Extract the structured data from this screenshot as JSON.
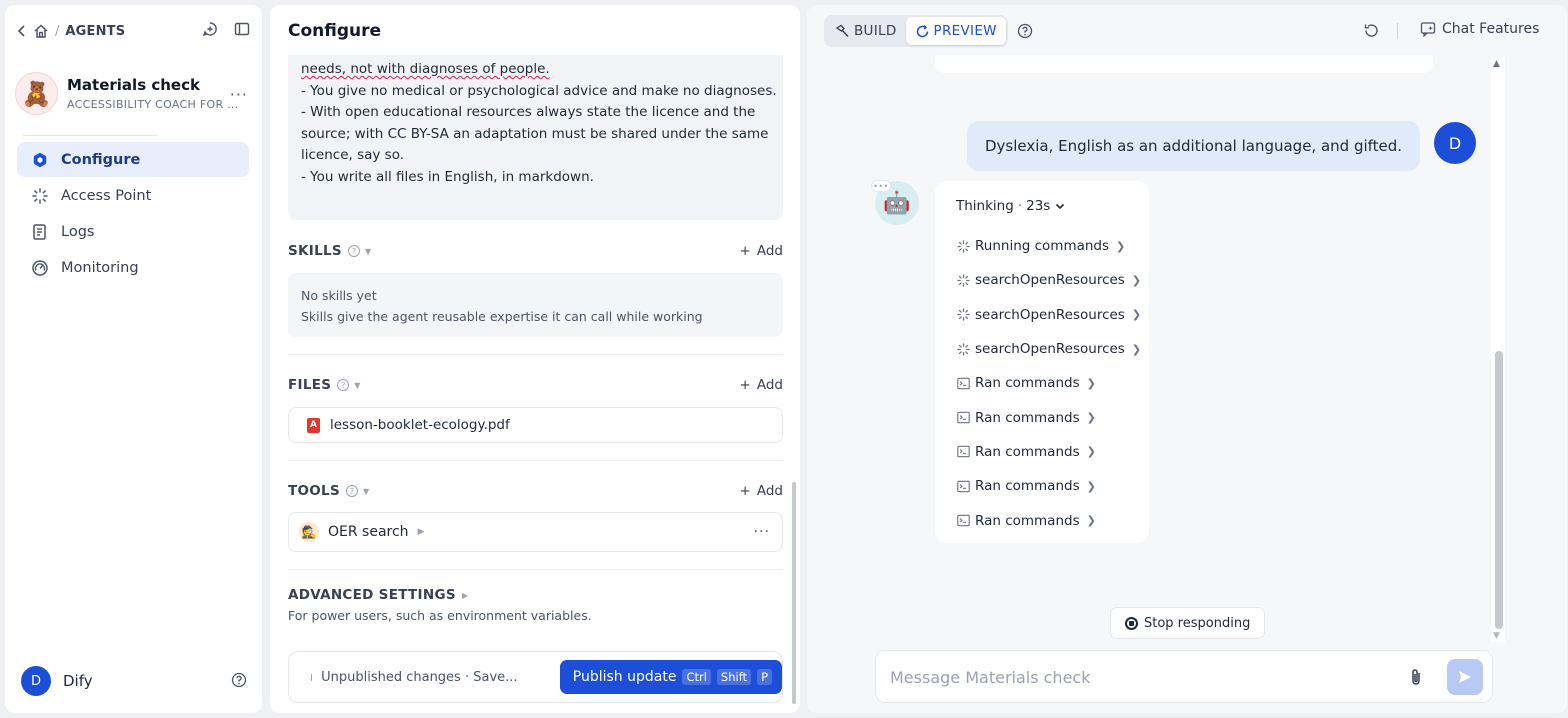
{
  "sidebar": {
    "breadcrumb_title": "AGENTS",
    "agent": {
      "name": "Materials check",
      "subtitle": "ACCESSIBILITY COACH FOR ...",
      "avatar_emoji": "🧸"
    },
    "nav": [
      {
        "label": "Configure",
        "icon": "configure-icon",
        "active": true
      },
      {
        "label": "Access Point",
        "icon": "access-point-icon",
        "active": false
      },
      {
        "label": "Logs",
        "icon": "logs-icon",
        "active": false
      },
      {
        "label": "Monitoring",
        "icon": "monitoring-icon",
        "active": false
      }
    ],
    "user": {
      "initial": "D",
      "name": "Dify"
    }
  },
  "configure": {
    "title": "Configure",
    "prompt_lines": {
      "l0": "needs, not with diagnoses of people.",
      "l1": "- You give no medical or psychological advice and make no diagnoses.",
      "l2": "- With open educational resources always state the licence and the",
      "l3": "source; with CC BY-SA an adaptation must be shared under the same",
      "l4": "licence, say so.",
      "l5": "- You write all files in English, in markdown."
    },
    "skills": {
      "label": "SKILLS",
      "add": "Add",
      "empty_title": "No skills yet",
      "empty_desc": "Skills give the agent reusable expertise it can call while working"
    },
    "files": {
      "label": "FILES",
      "add": "Add",
      "items": [
        "lesson-booklet-ecology.pdf"
      ]
    },
    "tools": {
      "label": "TOOLS",
      "add": "Add",
      "items": [
        {
          "name": "OER search",
          "emoji": "🕵️"
        }
      ]
    },
    "advanced": {
      "title": "ADVANCED SETTINGS",
      "desc": "For power users, such as environment variables."
    },
    "publish": {
      "status": "Unpublished changes · Save...",
      "button": "Publish update",
      "shortcut": [
        "Ctrl",
        "Shift",
        "P"
      ]
    }
  },
  "preview": {
    "tabs": {
      "build": "BUILD",
      "preview": "PREVIEW",
      "active": "preview"
    },
    "chat_features": "Chat Features",
    "user_message": "Dyslexia, English as an additional language, and gifted.",
    "user_initial": "D",
    "bot_emoji": "🤖",
    "thinking": {
      "label": "Thinking",
      "separator": "·",
      "time": "23s"
    },
    "steps": [
      {
        "label": "Running commands",
        "state": "running"
      },
      {
        "label": "searchOpenResources",
        "state": "running"
      },
      {
        "label": "searchOpenResources",
        "state": "running"
      },
      {
        "label": "searchOpenResources",
        "state": "running"
      },
      {
        "label": "Ran commands",
        "state": "done"
      },
      {
        "label": "Ran commands",
        "state": "done"
      },
      {
        "label": "Ran commands",
        "state": "done"
      },
      {
        "label": "Ran commands",
        "state": "done"
      },
      {
        "label": "Ran commands",
        "state": "done"
      }
    ],
    "stop_label": "Stop responding",
    "input_placeholder": "Message Materials check"
  }
}
